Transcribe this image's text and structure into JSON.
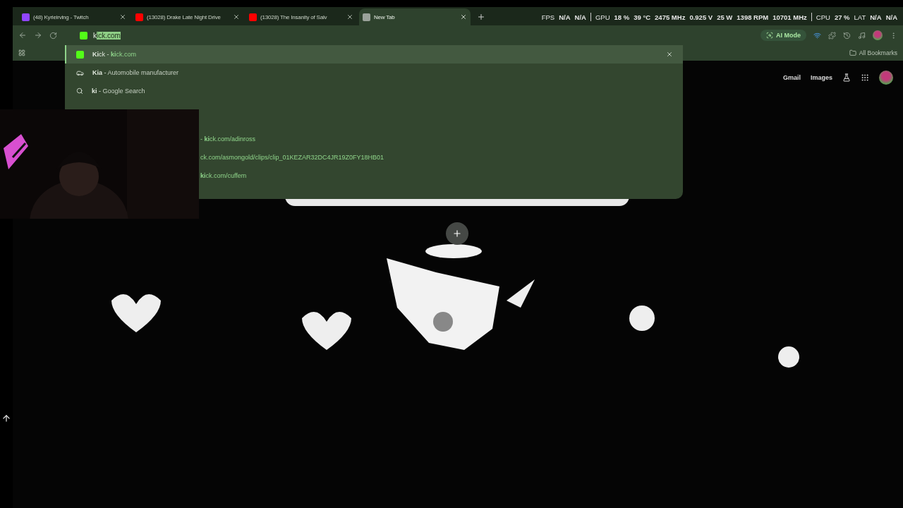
{
  "tabs": [
    {
      "title": "(48) Kyrieirving - Twitch",
      "kind": "twitch",
      "selected": false
    },
    {
      "title": "(13028) Drake Late Night Drive",
      "kind": "youtube",
      "selected": false
    },
    {
      "title": "(13028) The Insanity of Salv",
      "kind": "youtube",
      "selected": false
    },
    {
      "title": "New Tab",
      "kind": "chrome",
      "selected": true
    }
  ],
  "performance_overlay": [
    {
      "label": "FPS",
      "values": [
        "N/A",
        "N/A"
      ]
    },
    {
      "label": "GPU",
      "values": [
        "18 %",
        "39 °C",
        "2475 MHz",
        "0.925 V",
        "25 W",
        "1398 RPM",
        "10701 MHz"
      ]
    },
    {
      "label": "CPU",
      "values": [
        "27 %"
      ]
    },
    {
      "label": "LAT",
      "values": [
        "N/A",
        "N/A"
      ]
    }
  ],
  "omnibox": {
    "typed": "k",
    "autocomplete": "ick.com"
  },
  "ai_mode_button": "AI Mode",
  "all_bookmarks": "All Bookmarks",
  "suggestions": [
    {
      "kind": "site",
      "title": "**Ki**ck",
      "separator": "-",
      "detail": "**ki**ck.com",
      "selected": true
    },
    {
      "kind": "entity",
      "title": "**Kia**",
      "separator": "-",
      "detail": "Automobile manufacturer",
      "selected": false
    },
    {
      "kind": "search",
      "title": "**ki**",
      "separator": "-",
      "detail": "Google Search",
      "selected": false
    }
  ],
  "covered_suggestions": [
    "- **ki**ck.com/adinross",
    "ck.com/asmongold/clips/clip_01KEZAR32DC4JR19Z0FY18HB01",
    "**ki**ck.com/cuffem"
  ],
  "google_links": [
    "Gmail",
    "Images"
  ]
}
